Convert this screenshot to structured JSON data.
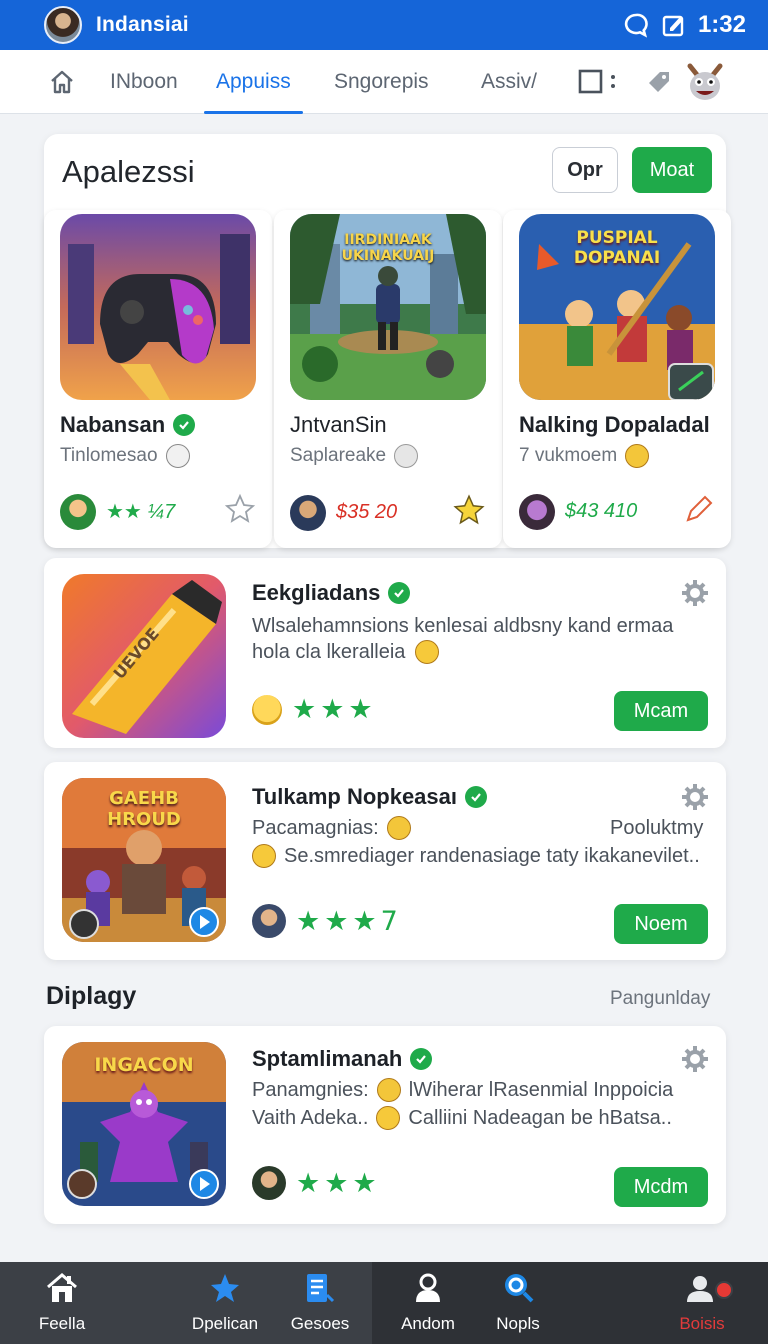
{
  "status_bar": {
    "title": "Indansiai",
    "time": "1:32"
  },
  "tabs": [
    {
      "label": "INboon"
    },
    {
      "label": "Appuiss"
    },
    {
      "label": "Sngorepis"
    },
    {
      "label": "Assiv/"
    }
  ],
  "panel": {
    "title": "Apalezssi",
    "outline_button": "Opr",
    "green_button": "Moat",
    "apps": [
      {
        "name": "Nabansan",
        "subtitle": "Tinlomesao",
        "rating": "★★ ¼7",
        "rating_color": "#1faa4a",
        "art_label": ""
      },
      {
        "name": "JntvanSin",
        "subtitle": "Saplareake",
        "rating": "$35 20",
        "rating_color": "#d93025",
        "art_label": "IIRDINIAAK\nUKINAKUAIJ"
      },
      {
        "name": "Nalking Dopaladal",
        "subtitle": "7 vukmoem",
        "rating": "$43 410",
        "rating_color": "#1faa4a",
        "art_label": "PUSPIAL\nDOPANAI"
      }
    ]
  },
  "cards": [
    {
      "title": "Eekgliadans",
      "line1": "Wlsalehamnsions kenlesai aldbsny kand ermaa",
      "line2": "hola cla lkeralleia",
      "stars": "★★★",
      "button": "Mcam",
      "art_label": "UEVOE"
    },
    {
      "title": "Tulkamp Nopkeasaı",
      "line1_left": "Pacamagnias:",
      "line1_right": "Pooluktmy",
      "line2": "Se.smrediager randenasiage taty ikakanevilet..",
      "stars": "★★★7",
      "button": "Noem",
      "art_label": "GAEHB\nHROUD"
    }
  ],
  "section": {
    "label": "Diplagy",
    "link": "Pangunlday"
  },
  "card3": {
    "title": "Sptamlimanah",
    "line1_left": "Panamgnies:",
    "line1_right": "lWiherar lRasenmial Inppoicia",
    "line2_left": "Vaith Adeka..",
    "line2_right": "Calliini Nadeagan be hBatsa..",
    "stars": "★★★",
    "button": "Mcdm",
    "art_label": "INGACON"
  },
  "bottom_nav": [
    {
      "label": "Feella",
      "icon": "home-icon"
    },
    {
      "label": "Dpelican",
      "icon": "star-icon"
    },
    {
      "label": "Gesoes",
      "icon": "document-icon"
    },
    {
      "label": "Andom",
      "icon": "person-icon"
    },
    {
      "label": "Nopls",
      "icon": "search-icon"
    },
    {
      "label": "Boisis",
      "icon": "profile-badge-icon"
    }
  ],
  "colors": {
    "accent": "#1a73e8",
    "status_bar": "#1565d8",
    "green": "#1faa4a",
    "danger": "#d93025"
  }
}
